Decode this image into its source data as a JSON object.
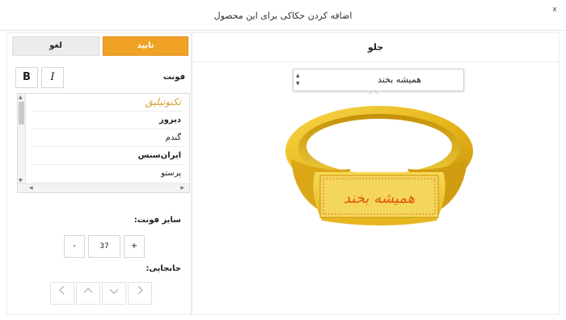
{
  "header": {
    "title": "اضافه کردن حکاکی برای این محصول",
    "close_label": "x"
  },
  "actions": {
    "confirm_label": "تایید",
    "cancel_label": "لغو"
  },
  "font_panel": {
    "label": "فونت",
    "bold_label": "B",
    "italic_label": "I",
    "fonts": [
      {
        "name": "تکنوتیلیق",
        "selected": true
      },
      {
        "name": "دیروز",
        "selected": false
      },
      {
        "name": "گندم",
        "selected": false
      },
      {
        "name": "ایران‌سنس",
        "selected": false
      },
      {
        "name": "پرستو",
        "selected": false
      }
    ]
  },
  "size_panel": {
    "label": "سایز فونت:",
    "minus_label": "-",
    "value": "37",
    "plus_label": "+"
  },
  "move_panel": {
    "label": "جابجایی:"
  },
  "preview": {
    "tab_label": "جلو",
    "engrave_input": "همیشه بخند",
    "engraving_text": "همیشه بخند"
  },
  "colors": {
    "accent": "#f0a226",
    "gold": "#e8b81c",
    "engraving": "#e05a10"
  },
  "icons": {
    "move_left": "chevron-left-icon",
    "move_up": "chevron-up-icon",
    "move_down": "chevron-down-icon",
    "move_right": "chevron-right-icon"
  }
}
